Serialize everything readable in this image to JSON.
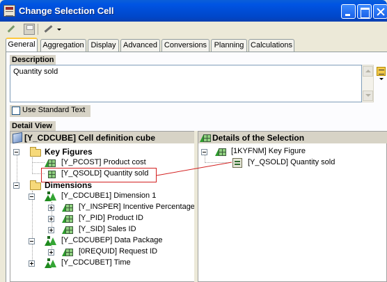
{
  "window": {
    "title": "Change Selection Cell"
  },
  "toolbar": {
    "icons": [
      "pencil-icon",
      "save-icon",
      "wrench-icon"
    ]
  },
  "tabs": [
    {
      "label": "General",
      "active": true
    },
    {
      "label": "Aggregation",
      "active": false
    },
    {
      "label": "Display",
      "active": false
    },
    {
      "label": "Advanced",
      "active": false
    },
    {
      "label": "Conversions",
      "active": false
    },
    {
      "label": "Planning",
      "active": false
    },
    {
      "label": "Calculations",
      "active": false
    }
  ],
  "description": {
    "header": "Description",
    "value": "Quantity sold",
    "use_standard_text_label": "Use Standard Text",
    "use_standard_text_checked": false
  },
  "detail_view": {
    "header": "Detail View",
    "left": {
      "header": "[Y_CDCUBE] Cell definition cube",
      "key_figures_folder": "Key Figures",
      "pcost": "[Y_PCOST] Product cost",
      "qsold": "[Y_QSOLD] Quantity sold",
      "dimensions_folder": "Dimensions",
      "dim1": "[Y_CDCUBE1] Dimension 1",
      "insper": "[Y_INSPER] Incentive Percentage",
      "pid": "[Y_PID] Product ID",
      "sid": "[Y_SID] Sales ID",
      "dimp": "[Y_CDCUBEP] Data Package",
      "requid": "[0REQUID] Request ID",
      "dimt": "[Y_CDCUBET] Time"
    },
    "right": {
      "header": "Details of the Selection",
      "key_figure": "[1KYFNM] Key Figure",
      "qsold": "[Y_QSOLD] Quantity sold"
    }
  },
  "colors": {
    "titlebar": "#0054e3",
    "highlight": "#d32020",
    "pane_header": "#d7d3c6"
  }
}
